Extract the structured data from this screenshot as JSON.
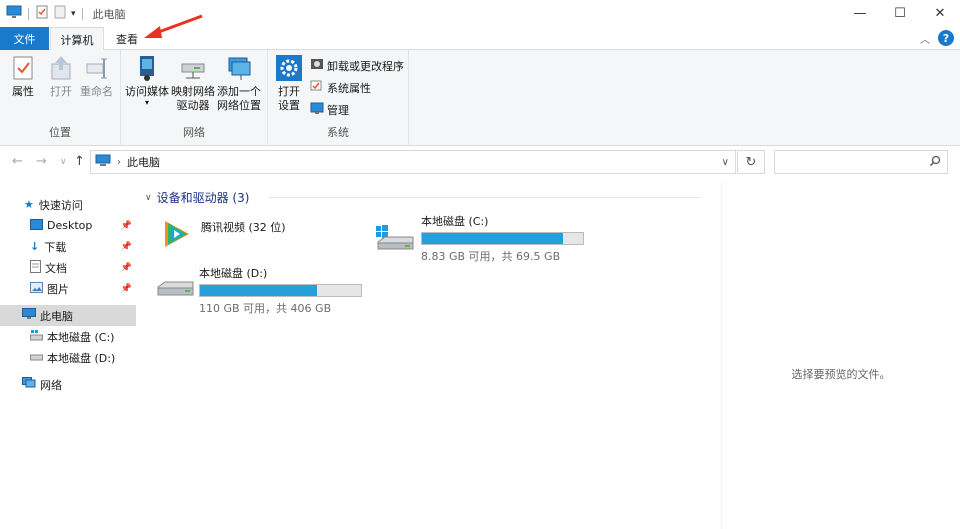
{
  "window": {
    "title": "此电脑"
  },
  "tabs": {
    "file": "文件",
    "computer": "计算机",
    "view": "查看"
  },
  "ribbon": {
    "location": {
      "label": "位置",
      "properties": "属性",
      "open": "打开",
      "rename": "重命名"
    },
    "network": {
      "label": "网络",
      "access_media": "访问媒体",
      "map_drive_line1": "映射网络",
      "map_drive_line2": "驱动器",
      "add_location_line1": "添加一个",
      "add_location_line2": "网络位置"
    },
    "system": {
      "label": "系统",
      "open_settings_line1": "打开",
      "open_settings_line2": "设置",
      "uninstall": "卸载或更改程序",
      "system_properties": "系统属性",
      "manage": "管理"
    }
  },
  "address": {
    "path": "此电脑"
  },
  "nav": {
    "quick_access": "快速访问",
    "desktop": "Desktop",
    "downloads": "下载",
    "documents": "文档",
    "pictures": "图片",
    "this_pc": "此电脑",
    "drive_c": "本地磁盘 (C:)",
    "drive_d": "本地磁盘 (D:)",
    "network": "网络"
  },
  "content": {
    "group_title": "设备和驱动器 (3)",
    "items": [
      {
        "name": "腾讯视频 (32 位)"
      },
      {
        "name": "本地磁盘 (C:)",
        "free": "8.83 GB 可用，共 69.5 GB",
        "used_fraction": 0.873
      },
      {
        "name": "本地磁盘 (D:)",
        "free": "110 GB 可用，共 406 GB",
        "used_fraction": 0.729
      }
    ]
  },
  "preview": {
    "text": "选择要预览的文件。"
  },
  "colors": {
    "accent": "#1979ca",
    "drive_bar": "#26a0da",
    "annotation_arrow": "#e8321e"
  }
}
